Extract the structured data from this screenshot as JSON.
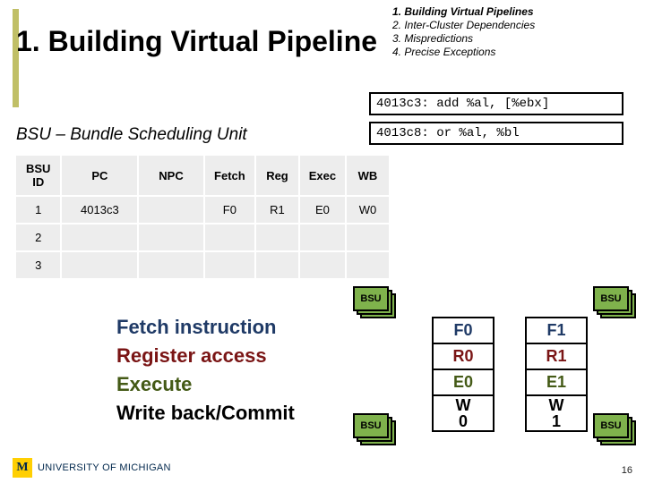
{
  "title": "1. Building Virtual Pipeline",
  "outline": {
    "l1": "1. Building Virtual Pipelines",
    "l2": "2. Inter-Cluster Dependencies",
    "l3": "3. Mispredictions",
    "l4": "4. Precise Exceptions"
  },
  "code": {
    "c1": "4013c3: add %al, [%ebx]",
    "c2": "4013c8: or %al, %bl"
  },
  "bsu_subtitle": "BSU – Bundle Scheduling Unit",
  "table": {
    "headers": [
      "BSU ID",
      "PC",
      "NPC",
      "Fetch",
      "Reg",
      "Exec",
      "WB"
    ],
    "rows": [
      {
        "id": "1",
        "pc": "4013c3",
        "npc": "",
        "f": "F0",
        "r": "R1",
        "e": "E0",
        "w": "W0"
      },
      {
        "id": "2",
        "pc": "",
        "npc": "",
        "f": "",
        "r": "",
        "e": "",
        "w": ""
      },
      {
        "id": "3",
        "pc": "",
        "npc": "",
        "f": "",
        "r": "",
        "e": "",
        "w": ""
      }
    ]
  },
  "stages": {
    "fetch": "Fetch instruction",
    "reg": "Register access",
    "exe": "Execute",
    "wb": "Write back/Commit"
  },
  "pipe0": {
    "f": "F0",
    "r": "R0",
    "e": "E0",
    "w": "W0"
  },
  "pipe1": {
    "f": "F1",
    "r": "R1",
    "e": "E1",
    "w": "W1"
  },
  "bsu_label": "BSU",
  "footer": {
    "m": "M",
    "uni": "UNIVERSITY OF MICHIGAN"
  },
  "page": "16"
}
